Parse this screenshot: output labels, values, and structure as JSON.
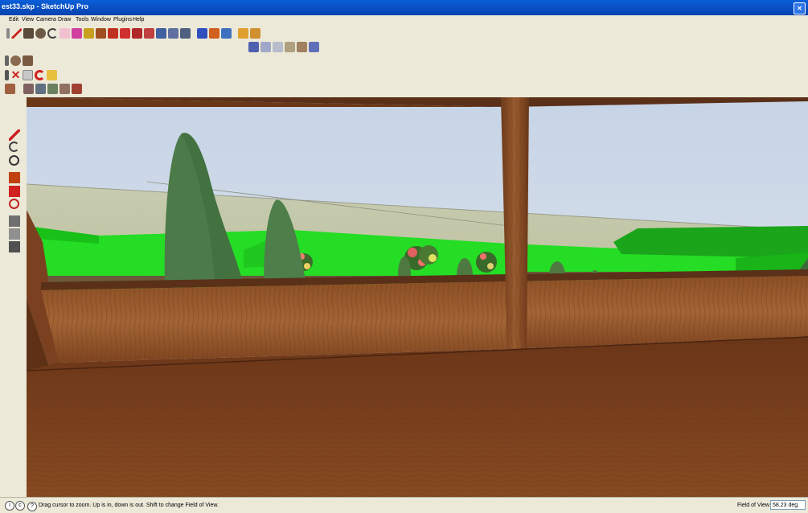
{
  "window": {
    "title": "est33.skp - SketchUp Pro"
  },
  "menu": [
    "Edit",
    "View",
    "Camera",
    "Draw",
    "Tools",
    "Window",
    "Plugins",
    "Help"
  ],
  "toolbars": {
    "row1": [
      "select-icon",
      "line-icon",
      "rectangle-icon",
      "circle-icon",
      "arc-icon",
      "eraser-icon",
      "paint-bucket-icon",
      "push-pull-icon",
      "follow-me-icon",
      "move-icon",
      "rotate-icon",
      "offset-icon",
      "orbit-icon",
      "pan-icon",
      "zoom-icon",
      "zoom-extents-icon",
      "components-icon",
      "materials-icon",
      "3d-warehouse-icon",
      "layers-icon"
    ],
    "row2": [
      "iso-view-icon",
      "top-view-icon",
      "front-view-icon",
      "right-view-icon",
      "back-view-icon",
      "left-view-icon"
    ],
    "row3": [
      "walk-icon",
      "look-around-icon",
      "position-camera-icon"
    ],
    "row4": [
      "delete-icon",
      "section-icon",
      "redo-icon",
      "folder-icon"
    ],
    "row5": [
      "shadow-icon",
      "fog-icon",
      "styles-icon",
      "sandbox-icon",
      "solid-tools-icon",
      "dynamic-components-icon"
    ]
  },
  "left_toolbar": [
    "pencil-icon",
    "arc-icon",
    "protractor-icon",
    "tape-measure-icon",
    "axes-icon",
    "orbit-icon",
    "walk-icon",
    "position-camera-icon",
    "look-around-icon"
  ],
  "status": {
    "message": "Drag cursor to zoom.  Up is in, down is out.  Shift to change Field of View.",
    "fov_label": "Field of View",
    "fov_value": "58.23 deg."
  },
  "colors": {
    "titlebar": "#0a5fd8",
    "chrome": "#ece9d8",
    "grass": "#22dd22",
    "wood": "#8a4e24",
    "sky": "#ccd9e6"
  }
}
